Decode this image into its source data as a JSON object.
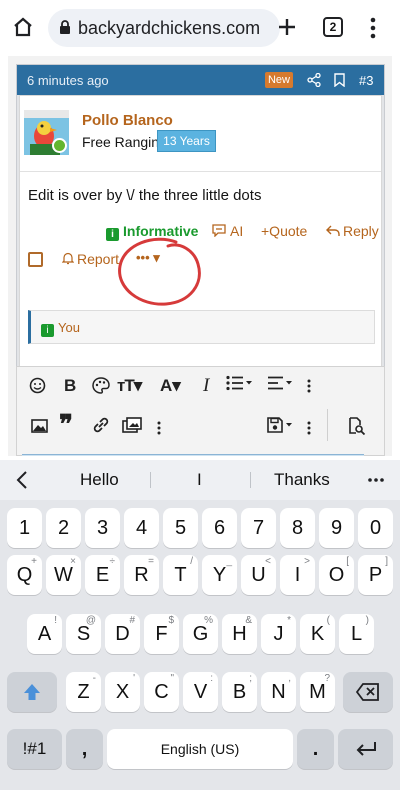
{
  "browser": {
    "url": "backyardchickens.com",
    "tab_count": "2"
  },
  "post": {
    "time": "6 minutes ago",
    "badge": "New",
    "number": "#3",
    "username": "Pollo Blanco",
    "user_title": "Free Ranging",
    "years_badge": "13 Years",
    "text": "Edit is over by \\/ the three little dots",
    "reaction_label": "Informative",
    "actions": {
      "ai": "AI",
      "quote": "+Quote",
      "reply": "Reply",
      "report": "Report",
      "more": "••• ▾"
    },
    "reactions_by": "You",
    "colors": {
      "header": "#2b6ea0",
      "accent": "#b5651d",
      "informative": "#1a9a2e",
      "years_badge": "#5bb3e0"
    }
  },
  "editor_toolbar": {
    "row1": [
      "smile-icon",
      "bold-icon",
      "palette-icon",
      "text-size-icon",
      "font-color-icon",
      "italic-icon",
      "list-icon",
      "align-icon",
      "more-vertical-icon"
    ],
    "row2": [
      "image-icon",
      "quote-icon",
      "link-icon",
      "media-icon",
      "more-vertical-icon",
      "save-draft-icon",
      "more-vertical-icon",
      "preview-icon"
    ]
  },
  "keyboard": {
    "suggestions": [
      "Hello",
      "I",
      "Thanks"
    ],
    "number_row": [
      "1",
      "2",
      "3",
      "4",
      "5",
      "6",
      "7",
      "8",
      "9",
      "0"
    ],
    "row1": [
      "Q",
      "W",
      "E",
      "R",
      "T",
      "Y",
      "U",
      "I",
      "O",
      "P"
    ],
    "row1_hints": [
      "+",
      "×",
      "÷",
      "=",
      "/",
      "_",
      "<",
      ">",
      "[",
      "]"
    ],
    "row2": [
      "A",
      "S",
      "D",
      "F",
      "G",
      "H",
      "J",
      "K",
      "L"
    ],
    "row2_hints": [
      "!",
      "@",
      "#",
      "$",
      "%",
      "&",
      "*",
      "(",
      ")"
    ],
    "row3": [
      "Z",
      "X",
      "C",
      "V",
      "B",
      "N",
      "M"
    ],
    "row3_hints": [
      "-",
      "'",
      "\"",
      ":",
      ";",
      ",",
      "?"
    ],
    "symbols_key": "!#1",
    "comma_key": ",",
    "space_label": "English (US)",
    "period_key": "."
  }
}
